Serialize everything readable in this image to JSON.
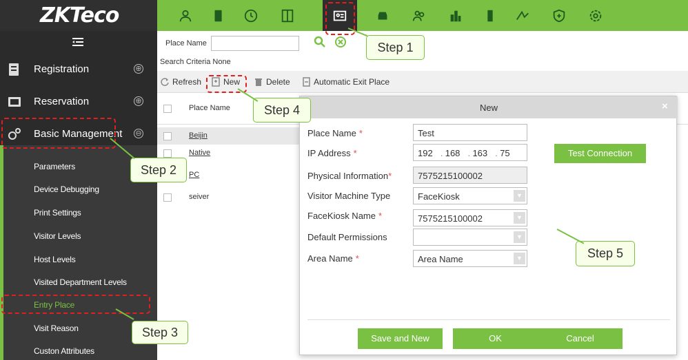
{
  "logo": "ZKTeco",
  "top_icons": [
    "person-icon",
    "door-icon",
    "clock-icon",
    "elevator-icon",
    "visitor-icon",
    "car-icon",
    "people-icon",
    "building-icon",
    "tower-icon",
    "patrol-icon",
    "shield-icon",
    "settings-icon"
  ],
  "sidebar": {
    "menus": [
      {
        "label": "Registration",
        "toggle": "⊕"
      },
      {
        "label": "Reservation",
        "toggle": "⊕"
      },
      {
        "label": "Basic Management",
        "toggle": "⊖"
      }
    ],
    "submenu": [
      "Parameters",
      "Device Debugging",
      "Print Settings",
      "Visitor Levels",
      "Host Levels",
      "Visited Department Levels",
      "Entry Place",
      "Visit Reason",
      "Custon Attributes"
    ]
  },
  "search": {
    "label": "Place Name",
    "value": "",
    "criteria": "Search Criteria None"
  },
  "toolbar": {
    "refresh": "Refresh",
    "new": "New",
    "delete": "Delete",
    "auto_exit": "Automatic Exit Place"
  },
  "grid": {
    "header": "Place Name",
    "rows": [
      "Beijin",
      "Native",
      "PC",
      "seiver"
    ]
  },
  "dialog": {
    "title": "New",
    "close": "×",
    "fields": {
      "place_name": {
        "label": "Place Name",
        "value": "Test"
      },
      "ip": {
        "label": "IP Address",
        "parts": [
          "192",
          "168",
          "163",
          "75"
        ]
      },
      "physical": {
        "label": "Physical Information",
        "value": "7575215100002"
      },
      "machine_type": {
        "label": "Visitor Machine Type",
        "value": "FaceKiosk"
      },
      "kiosk_name": {
        "label": "FaceKiosk Name",
        "value": "7575215100002"
      },
      "permissions": {
        "label": "Default Permissions",
        "value": ""
      },
      "area": {
        "label": "Area Name",
        "value": "Area Name"
      }
    },
    "test_connection": "Test Connection",
    "buttons": {
      "save_new": "Save and New",
      "ok": "OK",
      "cancel": "Cancel"
    }
  },
  "steps": [
    "Step 1",
    "Step 2",
    "Step 3",
    "Step 4",
    "Step 5"
  ],
  "colors": {
    "accent": "#7ac143",
    "dark": "#2b2b2b",
    "highlight": "#e02020"
  }
}
